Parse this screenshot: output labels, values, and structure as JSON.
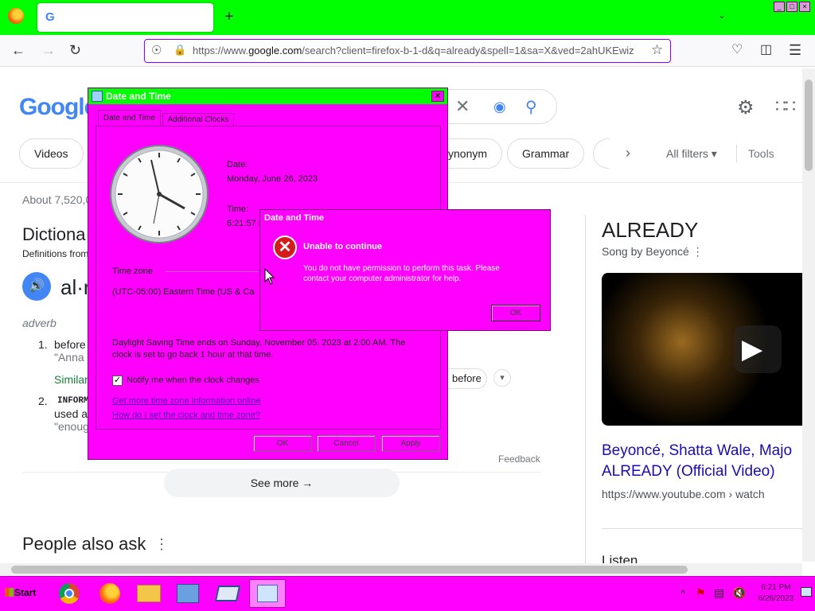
{
  "browser": {
    "tab_logo": "G",
    "new_tab": "+",
    "url_prefix": "https://www.",
    "url_domain": "google.com",
    "url_rest": "/search?client=firefox-b-1-d&q=already&spell=1&sa=X&ved=2ahUKEwiz"
  },
  "google": {
    "logo": "Google",
    "chips": [
      "Videos",
      "ynonym",
      "Grammar"
    ],
    "all_filters": "All filters",
    "tools": "Tools",
    "result_count": "About 7,520,0",
    "dict_heading": "Dictiona",
    "dict_sub": "Definitions from",
    "word": "al·r",
    "pos": "adverb",
    "def1_num": "1.",
    "def1": "before",
    "def1_ex": "\"Anna",
    "similar": "Similar",
    "before_chip": "before",
    "def2_num": "2.",
    "def2_tag": "INFORM",
    "def2": "used a",
    "def2_ex": "\"enoug",
    "feedback": "Feedback",
    "see_more": "See more",
    "people_ask": "People also ask",
    "panel_title": "ALREADY",
    "panel_sub": "Song by Beyoncé",
    "video_title1": "Beyoncé, Shatta Wale, Majo",
    "video_title2": "ALREADY (Official Video)",
    "video_source": "https://www.youtube.com › watch",
    "listen": "Listen"
  },
  "datetime_dialog": {
    "title": "Date and Time",
    "tab_date_time": "Date and Time",
    "tab_additional": "Additional Clocks",
    "date_label": "Date:",
    "date_value": "Monday, June 26, 2023",
    "time_label": "Time:",
    "time_value": "6:21:57 P",
    "timezone_label": "Time zone",
    "timezone_value": "(UTC-05:00) Eastern Time (US & Ca",
    "dst_line1": "Daylight Saving Time ends on Sunday, November 05, 2023 at 2:00 AM. The",
    "dst_line2": "clock is set to go back 1 hour at that time.",
    "notify_label": "Notify me when the clock changes",
    "notify_checked": true,
    "link1": "Get more time zone information online",
    "link2": "How do I set the clock and time zone?",
    "ok": "OK",
    "cancel": "Cancel",
    "apply": "Apply"
  },
  "error_dialog": {
    "title": "Date and Time",
    "heading": "Unable to continue",
    "message_line1": "You do not have permission to perform this task. Please",
    "message_line2": "contact your computer administrator for help.",
    "ok": "OK"
  },
  "taskbar": {
    "start": "Start",
    "clock_time": "6:21 PM",
    "clock_date": "6/26/2023"
  },
  "colors": {
    "titlebar_green": "#00ff00",
    "dialog_magenta": "#ff00ff",
    "link_blue": "#1a0dab"
  }
}
